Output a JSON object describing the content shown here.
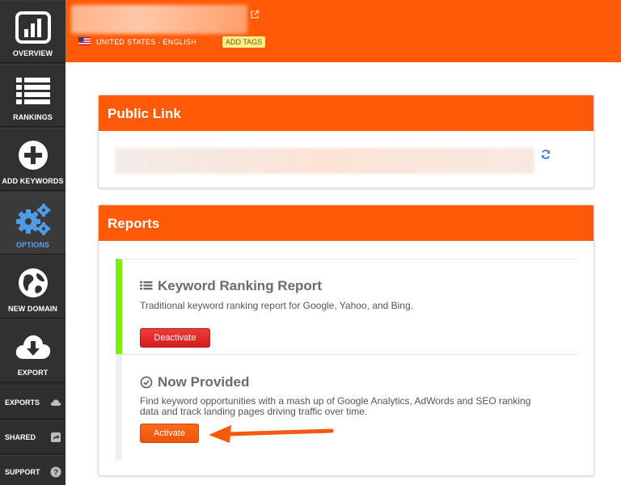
{
  "sidebar": {
    "items": [
      {
        "label": "OVERVIEW",
        "icon": "bar-chart-icon"
      },
      {
        "label": "RANKINGS",
        "icon": "list-icon"
      },
      {
        "label": "ADD KEYWORDS",
        "icon": "plus-circle-icon"
      },
      {
        "label": "OPTIONS",
        "icon": "gears-icon",
        "active": true
      },
      {
        "label": "NEW DOMAIN",
        "icon": "globe-icon"
      },
      {
        "label": "EXPORT",
        "icon": "cloud-download-icon"
      }
    ],
    "mini_items": [
      {
        "label": "EXPORTS",
        "icon": "cloud-icon"
      },
      {
        "label": "SHARED",
        "icon": "share-icon"
      },
      {
        "label": "SUPPORT",
        "icon": "help-icon"
      }
    ]
  },
  "header": {
    "locale": "UNITED STATES - ENGLISH",
    "add_tags": "ADD TAGS"
  },
  "public_link": {
    "title": "Public Link"
  },
  "reports": {
    "title": "Reports",
    "items": [
      {
        "title": "Keyword Ranking Report",
        "description": "Traditional keyword ranking report for Google, Yahoo, and Bing.",
        "button": "Deactivate"
      },
      {
        "title": "Now Provided",
        "description": "Find keyword opportunities with a mash up of Google Analytics, AdWords and SEO ranking data and track landing pages driving traffic over time.",
        "button": "Activate"
      }
    ]
  },
  "colors": {
    "brand_orange": "#ff5a08",
    "sidebar_dark": "#2b2b2b",
    "active_blue": "#5aa7f0",
    "active_green": "#7ded0c",
    "danger_red": "#d51d1d"
  }
}
